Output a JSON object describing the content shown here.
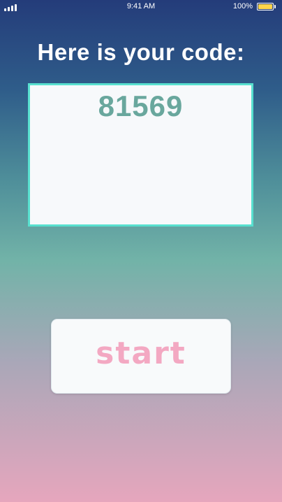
{
  "status_bar": {
    "time": "9:41 AM",
    "battery_percent": "100%",
    "icons": [
      "signal-icon",
      "battery-icon"
    ],
    "battery_color": "#ffd54a"
  },
  "main": {
    "title": "Here is your code:",
    "code": "81569",
    "start_label": "start"
  },
  "colors": {
    "gradient_top": "#243c7a",
    "gradient_middle": "#72b3a8",
    "gradient_bottom": "#e6a6bd",
    "code_box_border": "#58e0cf",
    "code_text": "#69a79d",
    "start_text": "#f3a8c2"
  }
}
